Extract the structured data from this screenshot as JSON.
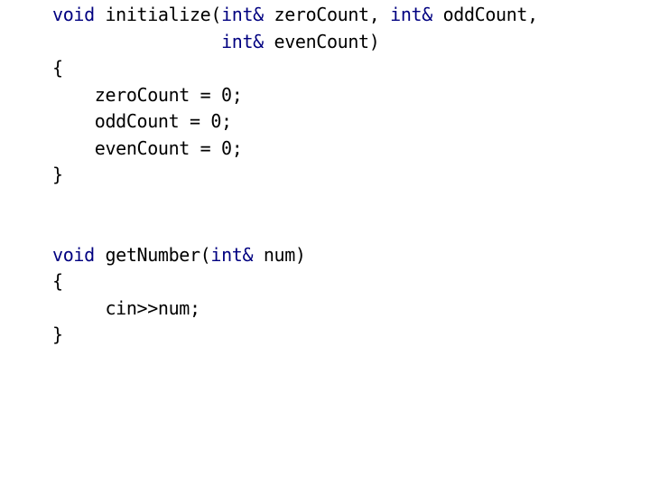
{
  "slide": {
    "background_color": "#ffffff",
    "keyword_color": "#000080",
    "text_color": "#000000",
    "language": "C++"
  },
  "code": {
    "lines": [
      {
        "id": "line-1",
        "indent": "",
        "text": "void initialize(int& zeroCount, int& oddCount,",
        "tokens": [
          {
            "t": "void",
            "k": "kw"
          },
          {
            "t": " initialize(",
            "k": "plain"
          },
          {
            "t": "int&",
            "k": "kw"
          },
          {
            "t": " zeroCount, ",
            "k": "plain"
          },
          {
            "t": "int&",
            "k": "kw"
          },
          {
            "t": " oddCount,",
            "k": "plain"
          }
        ]
      },
      {
        "id": "line-2",
        "indent": "                ",
        "text": "                int& evenCount)",
        "tokens": [
          {
            "t": "                ",
            "k": "plain"
          },
          {
            "t": "int&",
            "k": "kw"
          },
          {
            "t": " evenCount)",
            "k": "plain"
          }
        ]
      },
      {
        "id": "line-3",
        "indent": "",
        "text": "{",
        "tokens": [
          {
            "t": "{",
            "k": "plain"
          }
        ]
      },
      {
        "id": "line-4",
        "indent": "    ",
        "text": "    zeroCount = 0;",
        "tokens": [
          {
            "t": "    zeroCount = 0;",
            "k": "plain"
          }
        ]
      },
      {
        "id": "line-5",
        "indent": "    ",
        "text": "    oddCount = 0;",
        "tokens": [
          {
            "t": "    oddCount = 0;",
            "k": "plain"
          }
        ]
      },
      {
        "id": "line-6",
        "indent": "    ",
        "text": "    evenCount = 0;",
        "tokens": [
          {
            "t": "    evenCount = 0;",
            "k": "plain"
          }
        ]
      },
      {
        "id": "line-7",
        "indent": "",
        "text": "}",
        "tokens": [
          {
            "t": "}",
            "k": "plain"
          }
        ]
      },
      {
        "id": "line-8",
        "indent": "",
        "text": "",
        "tokens": []
      },
      {
        "id": "line-9",
        "indent": "",
        "text": "",
        "tokens": []
      },
      {
        "id": "line-10",
        "indent": "",
        "text": "void getNumber(int& num)",
        "tokens": [
          {
            "t": "void",
            "k": "kw"
          },
          {
            "t": " getNumber(",
            "k": "plain"
          },
          {
            "t": "int&",
            "k": "kw"
          },
          {
            "t": " num)",
            "k": "plain"
          }
        ]
      },
      {
        "id": "line-11",
        "indent": "",
        "text": "{",
        "tokens": [
          {
            "t": "{",
            "k": "plain"
          }
        ]
      },
      {
        "id": "line-12",
        "indent": "     ",
        "text": "     cin>>num;",
        "tokens": [
          {
            "t": "     cin>>num;",
            "k": "plain"
          }
        ]
      },
      {
        "id": "line-13",
        "indent": "",
        "text": "}",
        "tokens": [
          {
            "t": "}",
            "k": "plain"
          }
        ]
      }
    ]
  }
}
